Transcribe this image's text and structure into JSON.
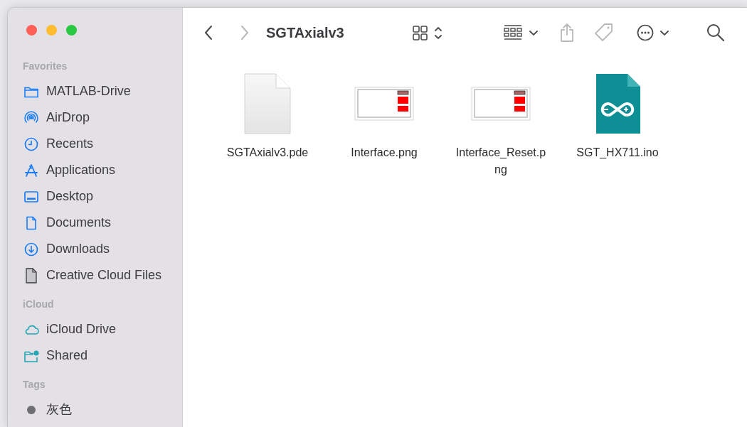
{
  "window": {
    "controls": [
      {
        "kind": "close"
      },
      {
        "kind": "minimize"
      },
      {
        "kind": "zoom"
      }
    ]
  },
  "sidebar": {
    "sections": [
      {
        "title": "Favorites",
        "items": [
          {
            "label": "MATLAB-Drive",
            "kind": "folder"
          },
          {
            "label": "AirDrop",
            "kind": "airdrop"
          },
          {
            "label": "Recents",
            "kind": "clock"
          },
          {
            "label": "Applications",
            "kind": "apps"
          },
          {
            "label": "Desktop",
            "kind": "desktop"
          },
          {
            "label": "Documents",
            "kind": "document"
          },
          {
            "label": "Downloads",
            "kind": "download"
          },
          {
            "label": "Creative Cloud Files",
            "kind": "file"
          }
        ]
      },
      {
        "title": "iCloud",
        "items": [
          {
            "label": "iCloud Drive",
            "kind": "cloud"
          },
          {
            "label": "Shared",
            "kind": "shared"
          }
        ]
      },
      {
        "title": "Tags",
        "items": [
          {
            "label": "灰色",
            "kind": "tag",
            "color": "#6e6d72"
          }
        ]
      }
    ]
  },
  "toolbar": {
    "title": "SGTAxialv3",
    "buttons": [
      {
        "kind": "back",
        "disabled": false
      },
      {
        "kind": "forward",
        "disabled": true
      },
      {
        "kind": "view",
        "disabled": false
      },
      {
        "kind": "group",
        "disabled": false
      },
      {
        "kind": "share",
        "disabled": true
      },
      {
        "kind": "tag",
        "disabled": true
      },
      {
        "kind": "more",
        "disabled": false
      },
      {
        "kind": "search",
        "disabled": false
      }
    ]
  },
  "files": [
    {
      "name": "SGTAxialv3.pde",
      "kind": "document"
    },
    {
      "name": "Interface.png",
      "kind": "image"
    },
    {
      "name": "Interface_Reset.png",
      "kind": "image"
    },
    {
      "name": "SGT_HX711.ino",
      "kind": "arduino"
    }
  ]
}
